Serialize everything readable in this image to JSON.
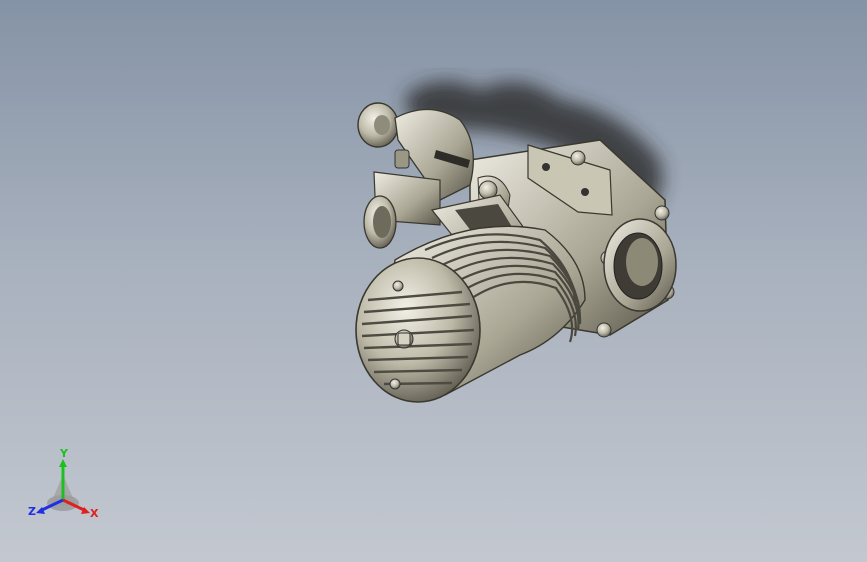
{
  "viewport": {
    "background_top": "#8593a6",
    "background_bottom": "#c3c8d0",
    "model": "engine-3d-model"
  },
  "triad": {
    "x_label": "X",
    "y_label": "Y",
    "z_label": "Z",
    "x_color": "#e02020",
    "y_color": "#1fbf1f",
    "z_color": "#2030e0"
  }
}
